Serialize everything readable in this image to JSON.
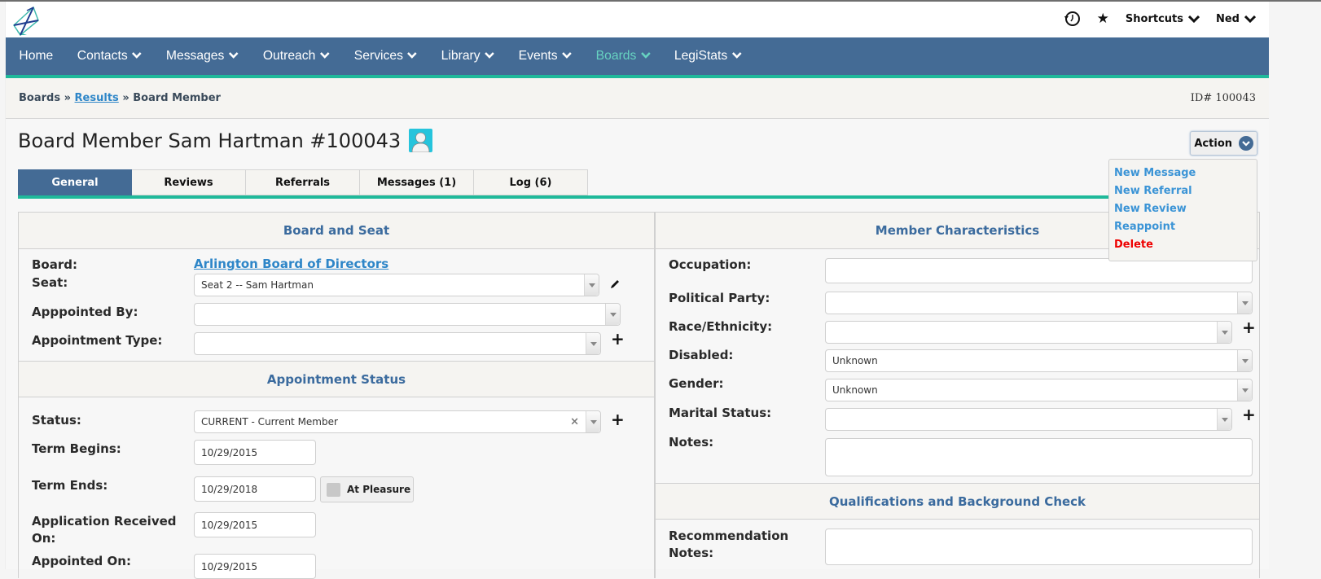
{
  "topbar": {
    "history_icon": "history-icon",
    "favorites_icon": "star-icon",
    "shortcuts_label": "Shortcuts",
    "user_label": "Ned"
  },
  "nav": {
    "items": [
      {
        "label": "Home",
        "dropdown": false
      },
      {
        "label": "Contacts",
        "dropdown": true
      },
      {
        "label": "Messages",
        "dropdown": true
      },
      {
        "label": "Outreach",
        "dropdown": true
      },
      {
        "label": "Services",
        "dropdown": true
      },
      {
        "label": "Library",
        "dropdown": true
      },
      {
        "label": "Events",
        "dropdown": true
      },
      {
        "label": "Boards",
        "dropdown": true,
        "active": true
      },
      {
        "label": "LegiStats",
        "dropdown": true
      }
    ],
    "active_color": "#67d3c1",
    "bar_color": "#446b95",
    "accent_color": "#1fb99a"
  },
  "breadcrumb": {
    "root": "Boards",
    "sep": "»",
    "link": "Results",
    "current": "Board Member",
    "id_text": "ID# 100043"
  },
  "header": {
    "title": "Board Member Sam Hartman #100043",
    "action_label": "Action",
    "action_menu": [
      {
        "label": "New Message",
        "danger": false
      },
      {
        "label": "New Referral",
        "danger": false
      },
      {
        "label": "New Review",
        "danger": false
      },
      {
        "label": "Reappoint",
        "danger": false
      },
      {
        "label": "Delete",
        "danger": true
      }
    ]
  },
  "tabs": [
    {
      "label": "General",
      "active": true
    },
    {
      "label": "Reviews"
    },
    {
      "label": "Referrals"
    },
    {
      "label": "Messages (1)"
    },
    {
      "label": "Log (6)"
    }
  ],
  "board_and_seat": {
    "heading": "Board and Seat",
    "board_label": "Board:",
    "board_value": "Arlington Board of Directors",
    "seat_label": "Seat:",
    "seat_value": "Seat 2 -- Sam Hartman",
    "appointed_by_label": "Apppointed By:",
    "appointed_by_value": "",
    "appointment_type_label": "Appointment Type:",
    "appointment_type_value": ""
  },
  "appointment_status": {
    "heading": "Appointment Status",
    "status_label": "Status:",
    "status_value": "CURRENT - Current Member",
    "term_begins_label": "Term Begins:",
    "term_begins_value": "10/29/2015",
    "term_ends_label": "Term Ends:",
    "term_ends_value": "10/29/2018",
    "at_pleasure_label": "At Pleasure",
    "at_pleasure_checked": false,
    "app_received_label": "Application Received On:",
    "app_received_value": "10/29/2015",
    "appointed_on_label": "Appointed On:",
    "appointed_on_value": "10/29/2015"
  },
  "member_characteristics": {
    "heading": "Member Characteristics",
    "occupation_label": "Occupation:",
    "occupation_value": "",
    "political_party_label": "Political Party:",
    "political_party_value": "",
    "race_label": "Race/Ethnicity:",
    "race_value": "",
    "disabled_label": "Disabled:",
    "disabled_value": "Unknown",
    "gender_label": "Gender:",
    "gender_value": "Unknown",
    "marital_label": "Marital Status:",
    "marital_value": "",
    "notes_label": "Notes:",
    "notes_value": ""
  },
  "qualifications": {
    "heading": "Qualifications and Background Check",
    "recommendation_label": "Recommendation Notes:",
    "recommendation_value": ""
  }
}
